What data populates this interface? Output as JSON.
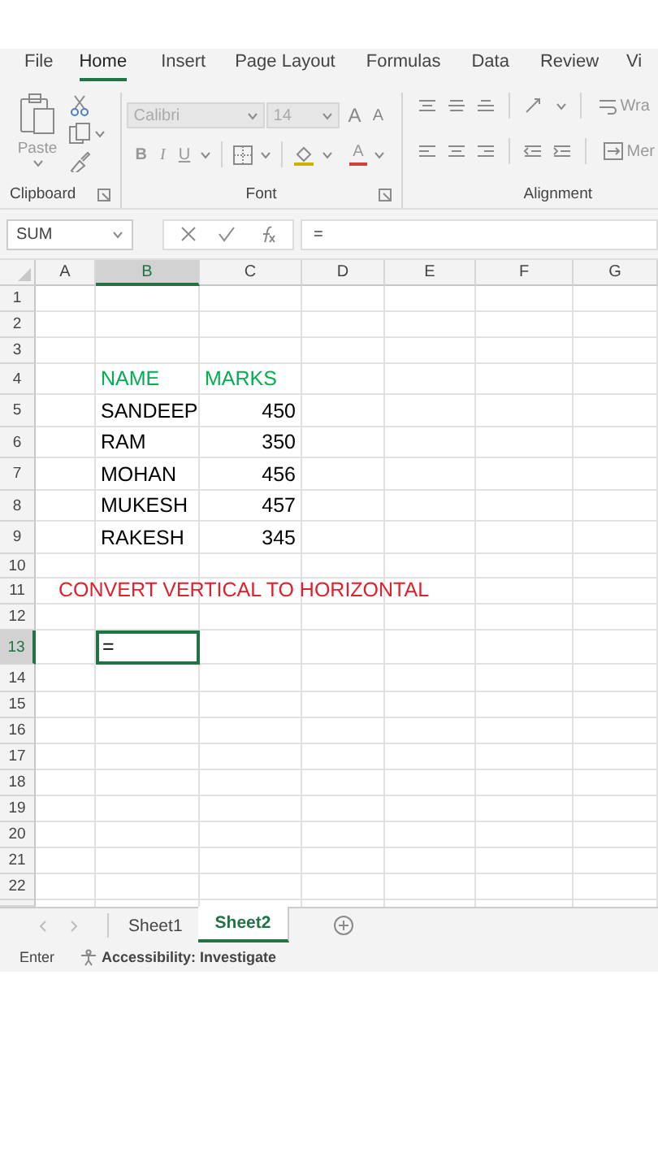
{
  "ribbon_tabs": [
    {
      "label": "File",
      "selected": false
    },
    {
      "label": "Home",
      "selected": true
    },
    {
      "label": "Insert",
      "selected": false
    },
    {
      "label": "Page Layout",
      "selected": false
    },
    {
      "label": "Formulas",
      "selected": false
    },
    {
      "label": "Data",
      "selected": false
    },
    {
      "label": "Review",
      "selected": false
    },
    {
      "label": "Vi",
      "selected": false
    }
  ],
  "clipboard": {
    "paste": "Paste",
    "group_label": "Clipboard"
  },
  "font": {
    "name": "Calibri",
    "size": "14",
    "grow": "A",
    "shrink": "A",
    "bold": "B",
    "italic": "I",
    "underline": "U",
    "font_color": "A",
    "group_label": "Font"
  },
  "alignment": {
    "wrap": "Wra",
    "merge": "Mer",
    "group_label": "Alignment"
  },
  "formula_bar": {
    "name_box": "SUM",
    "formula": "="
  },
  "grid": {
    "columns": [
      {
        "label": "A",
        "selected": false
      },
      {
        "label": "B",
        "selected": true
      },
      {
        "label": "C",
        "selected": false
      },
      {
        "label": "D",
        "selected": false
      },
      {
        "label": "E",
        "selected": false
      },
      {
        "label": "F",
        "selected": false
      },
      {
        "label": "G",
        "selected": false
      }
    ],
    "rows": [
      {
        "label": "1",
        "selected": false,
        "cells": {}
      },
      {
        "label": "2",
        "selected": false,
        "cells": {}
      },
      {
        "label": "3",
        "selected": false,
        "cells": {}
      },
      {
        "label": "4",
        "selected": false,
        "cells": {
          "B": {
            "text": "NAME",
            "kind": "text",
            "color": "#00b050",
            "selected": false
          },
          "C": {
            "text": "MARKS",
            "kind": "text",
            "color": "#00b050",
            "selected": false
          }
        }
      },
      {
        "label": "5",
        "selected": false,
        "cells": {
          "B": {
            "text": "SANDEEP",
            "kind": "text",
            "color": "#000000",
            "selected": false
          },
          "C": {
            "text": "450",
            "kind": "number",
            "color": "#000000",
            "selected": false
          }
        }
      },
      {
        "label": "6",
        "selected": false,
        "cells": {
          "B": {
            "text": "RAM",
            "kind": "text",
            "color": "#000000",
            "selected": false
          },
          "C": {
            "text": "350",
            "kind": "number",
            "color": "#000000",
            "selected": false
          }
        }
      },
      {
        "label": "7",
        "selected": false,
        "cells": {
          "B": {
            "text": "MOHAN",
            "kind": "text",
            "color": "#000000",
            "selected": false
          },
          "C": {
            "text": "456",
            "kind": "number",
            "color": "#000000",
            "selected": false
          }
        }
      },
      {
        "label": "8",
        "selected": false,
        "cells": {
          "B": {
            "text": "MUKESH",
            "kind": "text",
            "color": "#000000",
            "selected": false
          },
          "C": {
            "text": "457",
            "kind": "number",
            "color": "#000000",
            "selected": false
          }
        }
      },
      {
        "label": "9",
        "selected": false,
        "cells": {
          "B": {
            "text": "RAKESH",
            "kind": "text",
            "color": "#000000",
            "selected": false
          },
          "C": {
            "text": "345",
            "kind": "number",
            "color": "#000000",
            "selected": false
          }
        }
      },
      {
        "label": "10",
        "selected": false,
        "cells": {}
      },
      {
        "label": "11",
        "selected": false,
        "cells": {
          "A": {
            "text": "CONVERT VERTICAL TO HORIZONTAL",
            "kind": "title",
            "color": "#e0202a",
            "selected": false
          }
        }
      },
      {
        "label": "12",
        "selected": false,
        "cells": {}
      },
      {
        "label": "13",
        "selected": true,
        "cells": {
          "B": {
            "text": "=",
            "kind": "text",
            "color": "#000000",
            "selected": true
          }
        }
      },
      {
        "label": "14",
        "selected": false,
        "cells": {}
      },
      {
        "label": "15",
        "selected": false,
        "cells": {}
      },
      {
        "label": "16",
        "selected": false,
        "cells": {}
      },
      {
        "label": "17",
        "selected": false,
        "cells": {}
      },
      {
        "label": "18",
        "selected": false,
        "cells": {}
      },
      {
        "label": "19",
        "selected": false,
        "cells": {}
      },
      {
        "label": "20",
        "selected": false,
        "cells": {}
      },
      {
        "label": "21",
        "selected": false,
        "cells": {}
      },
      {
        "label": "22",
        "selected": false,
        "cells": {}
      }
    ]
  },
  "sheet_tabs": [
    {
      "label": "Sheet1",
      "selected": false
    },
    {
      "label": "Sheet2",
      "selected": true
    }
  ],
  "status_bar": {
    "mode": "Enter",
    "accessibility": "Accessibility: Investigate"
  }
}
